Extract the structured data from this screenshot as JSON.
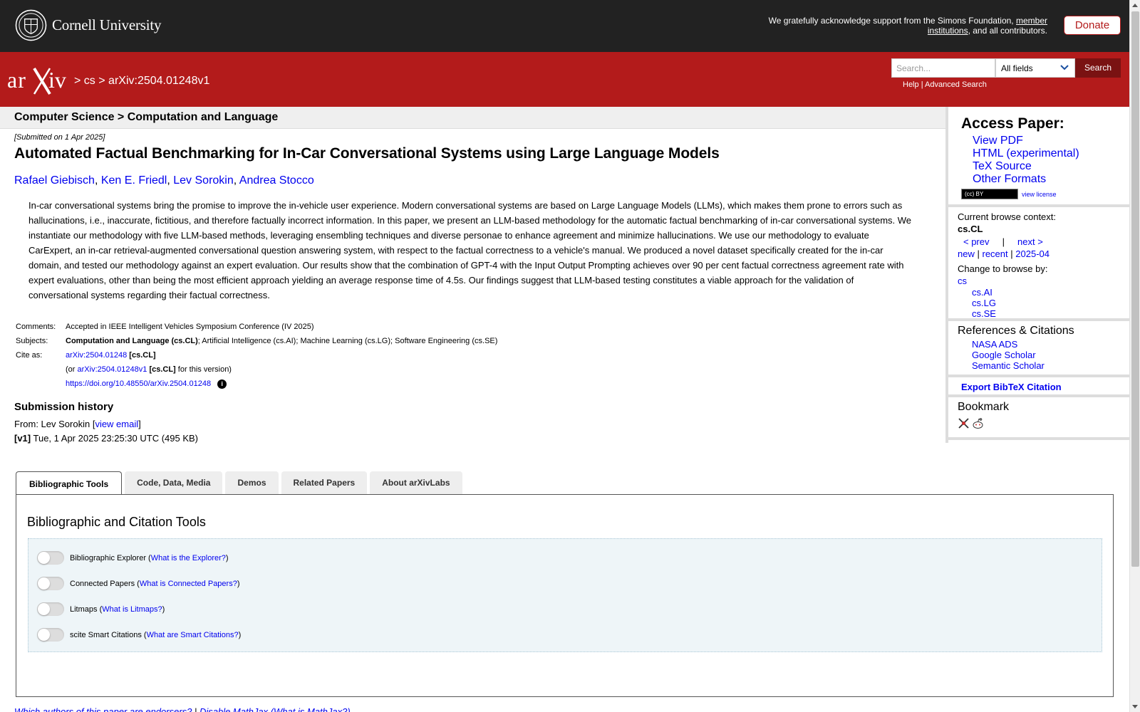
{
  "top": {
    "university": "Cornell University",
    "ack_text": "We gratefully acknowledge support from the Simons Foundation,",
    "ack_link": "member institutions",
    "ack_end": ", and all contributors.",
    "donate": "Donate"
  },
  "header": {
    "logo": "arXiv",
    "crumb_sep1": ">",
    "crumb_cs": "cs",
    "crumb_sep2": ">",
    "crumb_id": "arXiv:2504.01248v1",
    "search_placeholder": "Search...",
    "field_value": "All fields",
    "search_button": "Search",
    "help": "Help",
    "help_sep": "|",
    "advanced": "Advanced Search"
  },
  "subheader": {
    "title": "Computer Science > Computation and Language"
  },
  "paper": {
    "submitted": "[Submitted on 1 Apr 2025]",
    "title": "Automated Factual Benchmarking for In-Car Conversational Systems using Large Language Models",
    "authors": [
      "Rafael Giebisch",
      "Ken E. Friedl",
      "Lev Sorokin",
      "Andrea Stocco"
    ],
    "author_sep": ",",
    "abstract": "In-car conversational systems bring the promise to improve the in-vehicle user experience. Modern conversational systems are based on Large Language Models (LLMs), which makes them prone to errors such as hallucinations, i.e., inaccurate, fictitious, and therefore factually incorrect information. In this paper, we present an LLM-based methodology for the automatic factual benchmarking of in-car conversational systems. We instantiate our methodology with five LLM-based methods, leveraging ensembling techniques and diverse personae to enhance agreement and minimize hallucinations. We use our methodology to evaluate CarExpert, an in-car retrieval-augmented conversational question answering system, with respect to the factual correctness to a vehicle's manual. We produced a novel dataset specifically created for the in-car domain, and tested our methodology against an expert evaluation. Our results show that the combination of GPT-4 with the Input Output Prompting achieves over 90 per cent factual correctness agreement rate with expert evaluations, other than being the most efficient approach yielding an average response time of 4.5s. Our findings suggest that LLM-based testing constitutes a viable approach for the validation of conversational systems regarding their factual correctness."
  },
  "meta": {
    "comments_label": "Comments:",
    "comments": "Accepted in IEEE Intelligent Vehicles Symposium Conference (IV 2025)",
    "subjects_label": "Subjects:",
    "subjects_primary": "Computation and Language (cs.CL)",
    "subjects_rest": "; Artificial Intelligence (cs.AI); Machine Learning (cs.LG); Software Engineering (cs.SE)",
    "cite_label": "Cite as:",
    "cite_id": "arXiv:2504.01248",
    "cite_cat": "[cs.CL]",
    "cite_or": "(or",
    "cite_version": "arXiv:2504.01248v1",
    "cite_version_cat": "[cs.CL]",
    "cite_for": "for this version)",
    "doi": "https://doi.org/10.48550/arXiv.2504.01248",
    "info_glyph": "i"
  },
  "history": {
    "heading": "Submission history",
    "from_prefix": "From: Lev Sorokin [",
    "view_email": "view email",
    "from_suffix": "]",
    "version": "[v1]",
    "version_text": "Tue, 1 Apr 2025 23:25:30 UTC (495 KB)"
  },
  "sidebar": {
    "access_title": "Access Paper:",
    "access_links": [
      "View PDF",
      "HTML (experimental)",
      "TeX Source",
      "Other Formats"
    ],
    "cc_badge": "(cc) BY",
    "view_license": "view license",
    "browse_context_label": "Current browse context:",
    "browse_context": "cs.CL",
    "prev": "< prev",
    "nav_sep": "|",
    "next": "next >",
    "new": "new",
    "recent": "recent",
    "month": "2025-04",
    "change_browse": "Change to browse by:",
    "browse_cs": "cs",
    "browse_sub": [
      "cs.AI",
      "cs.LG",
      "cs.SE"
    ],
    "refs_title": "References & Citations",
    "refs": [
      "NASA ADS",
      "Google Scholar",
      "Semantic Scholar"
    ],
    "export": "Export BibTeX Citation",
    "bookmark_title": "Bookmark"
  },
  "tabs": [
    "Bibliographic Tools",
    "Code, Data, Media",
    "Demos",
    "Related Papers",
    "About arXivLabs"
  ],
  "tools": {
    "title": "Bibliographic and Citation Tools",
    "items": [
      {
        "name": "Bibliographic Explorer",
        "help": "What is the Explorer?"
      },
      {
        "name": "Connected Papers",
        "help": "What is Connected Papers?"
      },
      {
        "name": "Litmaps",
        "help": "What is Litmaps?"
      },
      {
        "name": "scite Smart Citations",
        "help": "What are Smart Citations?"
      }
    ]
  },
  "footer": {
    "endorsers": "Which authors of this paper are endorsers?",
    "sep": "|",
    "mathjax": "Disable MathJax",
    "mathjax_help": "(What is MathJax?)"
  }
}
